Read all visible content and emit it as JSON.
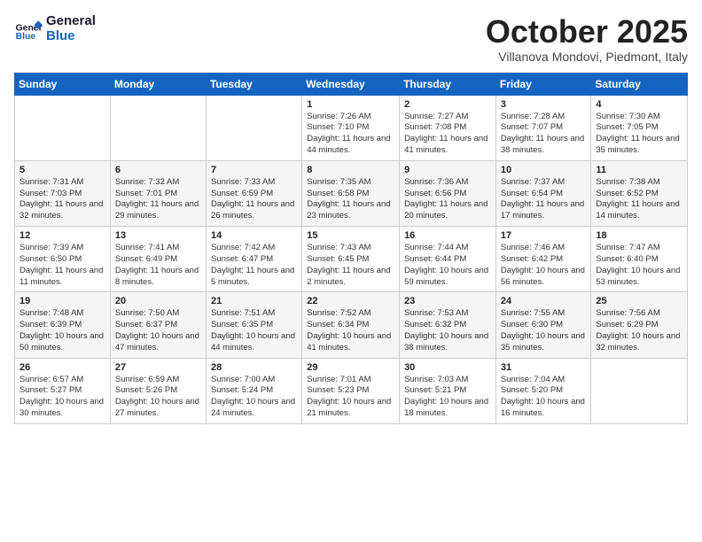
{
  "header": {
    "logo_line1": "General",
    "logo_line2": "Blue",
    "month": "October 2025",
    "location": "Villanova Mondovi, Piedmont, Italy"
  },
  "days_of_week": [
    "Sunday",
    "Monday",
    "Tuesday",
    "Wednesday",
    "Thursday",
    "Friday",
    "Saturday"
  ],
  "weeks": [
    [
      {
        "day": "",
        "info": ""
      },
      {
        "day": "",
        "info": ""
      },
      {
        "day": "",
        "info": ""
      },
      {
        "day": "1",
        "info": "Sunrise: 7:26 AM\nSunset: 7:10 PM\nDaylight: 11 hours and 44 minutes."
      },
      {
        "day": "2",
        "info": "Sunrise: 7:27 AM\nSunset: 7:08 PM\nDaylight: 11 hours and 41 minutes."
      },
      {
        "day": "3",
        "info": "Sunrise: 7:28 AM\nSunset: 7:07 PM\nDaylight: 11 hours and 38 minutes."
      },
      {
        "day": "4",
        "info": "Sunrise: 7:30 AM\nSunset: 7:05 PM\nDaylight: 11 hours and 35 minutes."
      }
    ],
    [
      {
        "day": "5",
        "info": "Sunrise: 7:31 AM\nSunset: 7:03 PM\nDaylight: 11 hours and 32 minutes."
      },
      {
        "day": "6",
        "info": "Sunrise: 7:32 AM\nSunset: 7:01 PM\nDaylight: 11 hours and 29 minutes."
      },
      {
        "day": "7",
        "info": "Sunrise: 7:33 AM\nSunset: 6:59 PM\nDaylight: 11 hours and 26 minutes."
      },
      {
        "day": "8",
        "info": "Sunrise: 7:35 AM\nSunset: 6:58 PM\nDaylight: 11 hours and 23 minutes."
      },
      {
        "day": "9",
        "info": "Sunrise: 7:36 AM\nSunset: 6:56 PM\nDaylight: 11 hours and 20 minutes."
      },
      {
        "day": "10",
        "info": "Sunrise: 7:37 AM\nSunset: 6:54 PM\nDaylight: 11 hours and 17 minutes."
      },
      {
        "day": "11",
        "info": "Sunrise: 7:38 AM\nSunset: 6:52 PM\nDaylight: 11 hours and 14 minutes."
      }
    ],
    [
      {
        "day": "12",
        "info": "Sunrise: 7:39 AM\nSunset: 6:50 PM\nDaylight: 11 hours and 11 minutes."
      },
      {
        "day": "13",
        "info": "Sunrise: 7:41 AM\nSunset: 6:49 PM\nDaylight: 11 hours and 8 minutes."
      },
      {
        "day": "14",
        "info": "Sunrise: 7:42 AM\nSunset: 6:47 PM\nDaylight: 11 hours and 5 minutes."
      },
      {
        "day": "15",
        "info": "Sunrise: 7:43 AM\nSunset: 6:45 PM\nDaylight: 11 hours and 2 minutes."
      },
      {
        "day": "16",
        "info": "Sunrise: 7:44 AM\nSunset: 6:44 PM\nDaylight: 10 hours and 59 minutes."
      },
      {
        "day": "17",
        "info": "Sunrise: 7:46 AM\nSunset: 6:42 PM\nDaylight: 10 hours and 56 minutes."
      },
      {
        "day": "18",
        "info": "Sunrise: 7:47 AM\nSunset: 6:40 PM\nDaylight: 10 hours and 53 minutes."
      }
    ],
    [
      {
        "day": "19",
        "info": "Sunrise: 7:48 AM\nSunset: 6:39 PM\nDaylight: 10 hours and 50 minutes."
      },
      {
        "day": "20",
        "info": "Sunrise: 7:50 AM\nSunset: 6:37 PM\nDaylight: 10 hours and 47 minutes."
      },
      {
        "day": "21",
        "info": "Sunrise: 7:51 AM\nSunset: 6:35 PM\nDaylight: 10 hours and 44 minutes."
      },
      {
        "day": "22",
        "info": "Sunrise: 7:52 AM\nSunset: 6:34 PM\nDaylight: 10 hours and 41 minutes."
      },
      {
        "day": "23",
        "info": "Sunrise: 7:53 AM\nSunset: 6:32 PM\nDaylight: 10 hours and 38 minutes."
      },
      {
        "day": "24",
        "info": "Sunrise: 7:55 AM\nSunset: 6:30 PM\nDaylight: 10 hours and 35 minutes."
      },
      {
        "day": "25",
        "info": "Sunrise: 7:56 AM\nSunset: 6:29 PM\nDaylight: 10 hours and 32 minutes."
      }
    ],
    [
      {
        "day": "26",
        "info": "Sunrise: 6:57 AM\nSunset: 5:27 PM\nDaylight: 10 hours and 30 minutes."
      },
      {
        "day": "27",
        "info": "Sunrise: 6:59 AM\nSunset: 5:26 PM\nDaylight: 10 hours and 27 minutes."
      },
      {
        "day": "28",
        "info": "Sunrise: 7:00 AM\nSunset: 5:24 PM\nDaylight: 10 hours and 24 minutes."
      },
      {
        "day": "29",
        "info": "Sunrise: 7:01 AM\nSunset: 5:23 PM\nDaylight: 10 hours and 21 minutes."
      },
      {
        "day": "30",
        "info": "Sunrise: 7:03 AM\nSunset: 5:21 PM\nDaylight: 10 hours and 18 minutes."
      },
      {
        "day": "31",
        "info": "Sunrise: 7:04 AM\nSunset: 5:20 PM\nDaylight: 10 hours and 16 minutes."
      },
      {
        "day": "",
        "info": ""
      }
    ]
  ]
}
